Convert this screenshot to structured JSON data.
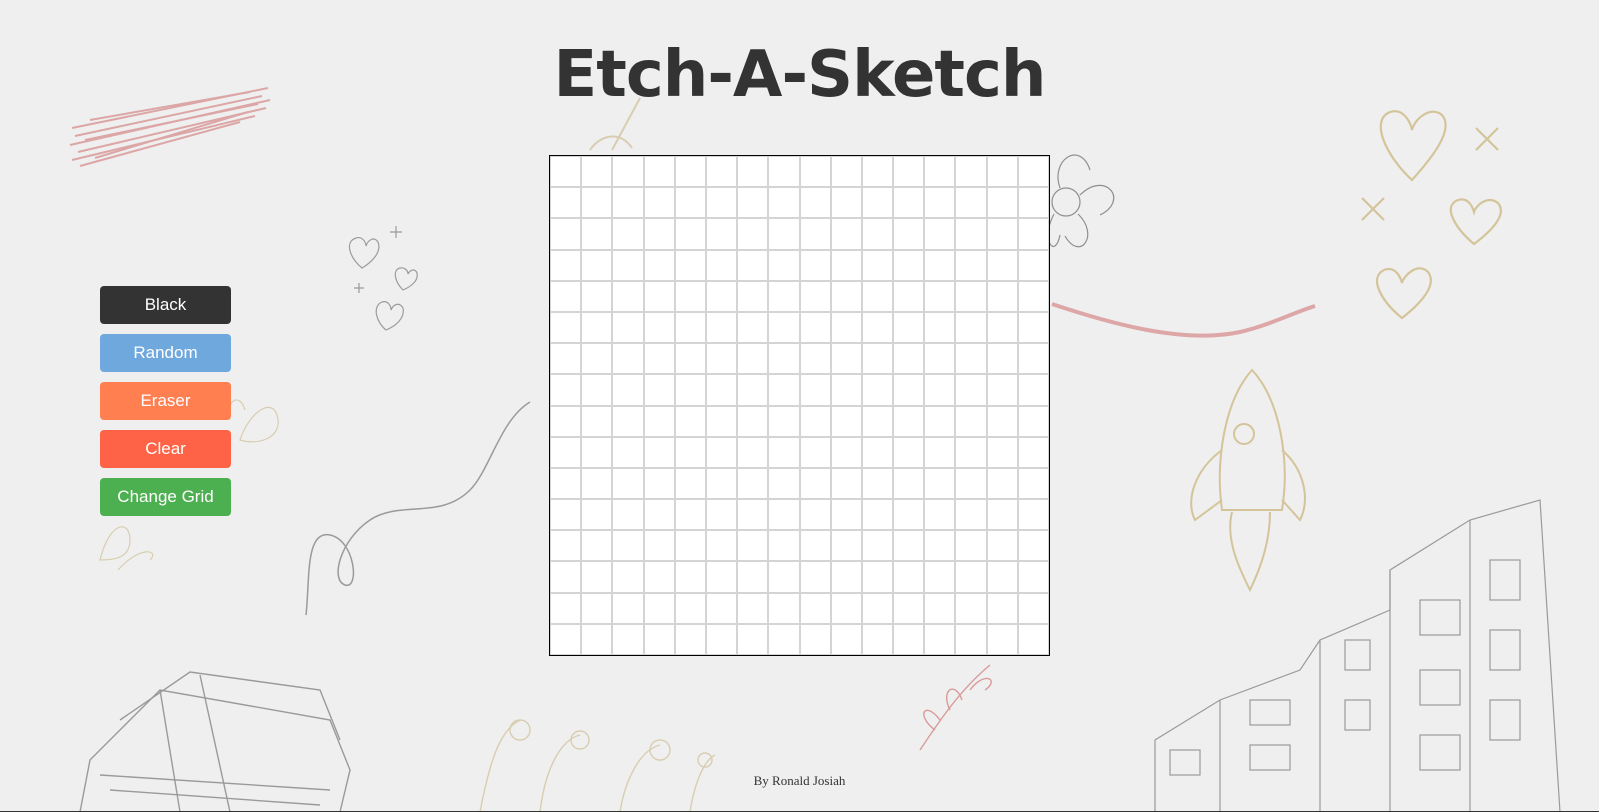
{
  "title": "Etch-A-Sketch",
  "buttons": [
    {
      "label": "Black",
      "color": "#333333"
    },
    {
      "label": "Random",
      "color": "#6fa8dc"
    },
    {
      "label": "Eraser",
      "color": "#ff7f50"
    },
    {
      "label": "Clear",
      "color": "#ff6347"
    },
    {
      "label": "Change Grid",
      "color": "#4caf50"
    }
  ],
  "grid": {
    "rows": 16,
    "cols": 16,
    "cell_color": "#ffffff",
    "line_color": "#d4d4d4"
  },
  "footer": "By Ronald Josiah",
  "background_icons": [
    "scribble-icon",
    "hearts-icon",
    "flower-icon",
    "rocket-icon",
    "books-icon",
    "building-icon",
    "plant-icon",
    "curly-line-icon"
  ]
}
